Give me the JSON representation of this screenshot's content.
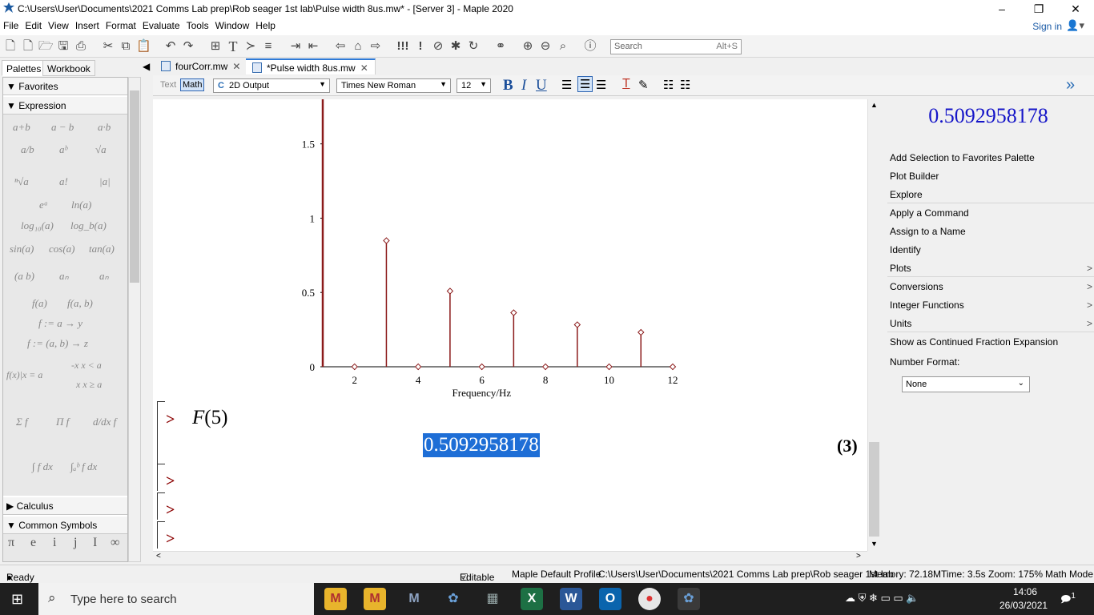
{
  "window": {
    "title": "C:\\Users\\User\\Documents\\2021 Comms Lab prep\\Rob seager 1st lab\\Pulse width 8us.mw* - [Server 3] - Maple 2020",
    "minimize": "–",
    "maximize": "❐",
    "close": "✕"
  },
  "menu": [
    "File",
    "Edit",
    "View",
    "Insert",
    "Format",
    "Evaluate",
    "Tools",
    "Window",
    "Help"
  ],
  "signin": "Sign in",
  "search": {
    "placeholder": "Search",
    "shortcut": "Alt+S"
  },
  "left_panel": {
    "tabs": [
      "Palettes",
      "Workbook"
    ],
    "sections": {
      "favorites": "Favorites",
      "expression": "Expression",
      "calculus": "Calculus",
      "common_symbols": "Common Symbols"
    },
    "expression_items": [
      "a+b",
      "a − b",
      "a·b",
      "a/b",
      "aᵇ",
      "√a",
      "ⁿ√a",
      "a!",
      "|a|",
      "eᵃ",
      "ln(a)",
      "log₁₀(a)",
      "log_b(a)",
      "sin(a)",
      "cos(a)",
      "tan(a)",
      "(a b)",
      "aₙ",
      "aₙ",
      "f(a)",
      "f(a, b)",
      "f := a → y",
      "f := (a, b) → z",
      "f(x)|x = a",
      "-x  x < a",
      "x  x ≥ a",
      "Σ f",
      "Π f",
      "d/dx f",
      "∫ f dx",
      "∫ₐᵇ f dx"
    ],
    "common_symbols": [
      "π",
      "e",
      "i",
      "j",
      "I",
      "∞"
    ]
  },
  "doc_tabs": [
    {
      "label": "fourCorr.mw",
      "close": "✕"
    },
    {
      "label": "*Pulse width 8us.mw",
      "close": "✕"
    }
  ],
  "format_bar": {
    "text_mode": "Text",
    "math_mode": "Math",
    "style": "2D Output",
    "font": "Times New Roman",
    "size": "12"
  },
  "worksheet": {
    "input_expr": "F(5)",
    "input_func": "F",
    "input_arg": "5",
    "output_value": "0.5092958178",
    "equation_label": "(3)",
    "prompt": ">"
  },
  "chart_data": {
    "type": "scatter",
    "style": "stem",
    "x": [
      1,
      2,
      3,
      4,
      5,
      6,
      7,
      8,
      9,
      10,
      11,
      12
    ],
    "y": [
      2.0,
      0,
      0.8488,
      0,
      0.5093,
      0,
      0.3638,
      0,
      0.2829,
      0,
      0.2315,
      0
    ],
    "xlabel": "Frequency/Hz",
    "ylabel": "",
    "xticks": [
      "2",
      "4",
      "6",
      "8",
      "10",
      "12"
    ],
    "yticks": [
      "0",
      "0.5",
      "1",
      "1.5"
    ],
    "xlim": [
      1,
      12
    ],
    "ylim": [
      0,
      1.8
    ],
    "color": "#8b1a1a"
  },
  "context_panel": {
    "value": "0.5092958178",
    "items": [
      "Add Selection to Favorites Palette",
      "Plot Builder",
      "Explore",
      "Apply a Command",
      "Assign to a Name",
      "Identify",
      "Plots",
      "Conversions",
      "Integer Functions",
      "Units",
      "Show as Continued Fraction Expansion"
    ],
    "number_format_label": "Number Format:",
    "number_format_value": "None"
  },
  "status": {
    "state": "Ready",
    "editable": "Editable",
    "profile": "Maple Default Profile",
    "path": "C:\\Users\\User\\Documents\\2021 Comms Lab prep\\Rob seager 1st lab",
    "memory": "Memory: 72.18M",
    "time": "Time: 3.5s",
    "zoom": "Zoom: 175%",
    "mode": "Math Mode"
  },
  "taskbar": {
    "search_placeholder": "Type here to search",
    "clock_time": "14:06",
    "clock_date": "26/03/2021",
    "notifications": "1"
  }
}
